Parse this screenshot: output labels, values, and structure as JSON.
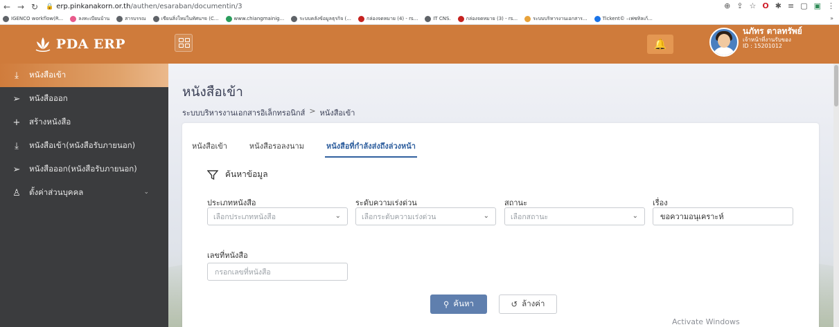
{
  "browser": {
    "url_host": "erp.pinkanakorn.or.th",
    "url_path": "/authen/esaraban/documentin/3",
    "bookmarks": [
      "IGENCO workflow(R...",
      "ลงทะเบียนบ้าน",
      "สารบรรณ",
      "เขียนสิ่งใหม่ในทัศนฯจ (C...",
      "www.chiangmainig...",
      "ระบบคลังข้อมูลธุรกิจ (...",
      "กล่องจดหมาย (4) - rs...",
      "IT CNS.",
      "กล่องจดหมาย (3) - rs...",
      "ระบบบริหารงานเอกสาร...",
      "Tickent© –เฟซทิลเก้..."
    ],
    "more": "»"
  },
  "app": {
    "logo_text": "PDA ERP",
    "user": {
      "name": "นภัทร ตาลทรัพย์",
      "role": "เจ้าหน้าที่งานรับของ",
      "id": "ID : 15201012"
    }
  },
  "sidebar": {
    "items": [
      {
        "label": "หนังสือเข้า",
        "icon": "inbox-download-icon"
      },
      {
        "label": "หนังสือออก",
        "icon": "send-icon"
      },
      {
        "label": "สร้างหนังสือ",
        "icon": "plus-icon"
      },
      {
        "label": "หนังสือเข้า(หนังสือรับภายนอก)",
        "icon": "inbox-download-icon"
      },
      {
        "label": "หนังสือออก(หนังสือรับภายนอก)",
        "icon": "send-icon"
      },
      {
        "label": "ตั้งค่าส่วนบุคคล",
        "icon": "user-icon"
      }
    ]
  },
  "main": {
    "title": "หนังสือเข้า",
    "breadcrumb": [
      "ระบบบริหารงานเอกสารอิเล็กทรอนิกส์",
      "หนังสือเข้า"
    ],
    "breadcrumb_sep": ">",
    "tabs": [
      "หนังสือเข้า",
      "หนังสือรอลงนาม",
      "หนังสือที่กำลังส่งถึงล่วงหน้า"
    ],
    "filter_title": "ค้นหาข้อมูล",
    "fields": {
      "doc_type": {
        "label": "ประเภทหนังสือ",
        "placeholder": "เลือกประเภทหนังสือ"
      },
      "urgency": {
        "label": "ระดับความเร่งด่วน",
        "placeholder": "เลือกระดับความเร่งด่วน"
      },
      "status": {
        "label": "สถานะ",
        "placeholder": "เลือกสถานะ"
      },
      "subject": {
        "label": "เรื่อง",
        "value": "ขอความอนุเคราะห์"
      },
      "doc_no": {
        "label": "เลขที่หนังสือ",
        "placeholder": "กรอกเลขที่หนังสือ"
      }
    },
    "search_label": "ค้นหา",
    "clear_label": "ล้างค่า"
  },
  "watermark": "Activate Windows",
  "colors": {
    "brand": "#cf7b3b",
    "sidebar": "#3b3c3e",
    "primary_button": "#5f7fae",
    "active_tab": "#2f5f9e"
  }
}
